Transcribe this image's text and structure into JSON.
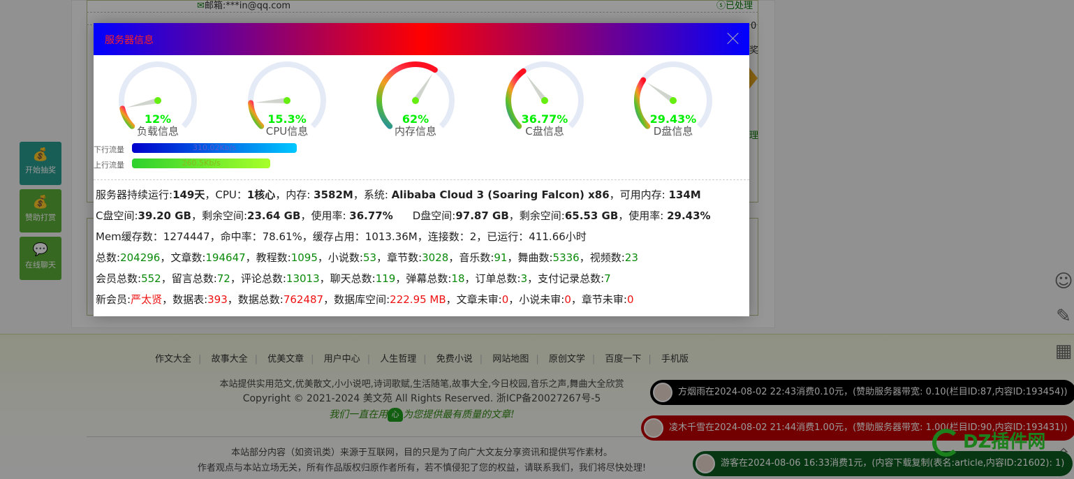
{
  "background": {
    "email_label": "邮箱:***in@qq.com",
    "processed_label": "已处理",
    "fragments": [
      "0",
      "奖",
      "理"
    ],
    "float_buttons": [
      {
        "label": "开始抽奖",
        "icon": "money-bag-icon",
        "color": "#2a9d8f"
      },
      {
        "label": "赞助打赏",
        "icon": "money-bag-icon",
        "color": "#5cae3a"
      },
      {
        "label": "在线聊天",
        "icon": "chat-bubbles-icon",
        "color": "#5cae3a"
      }
    ],
    "right_icons": [
      "smiley-icon",
      "edit-icon",
      "qrcode-icon",
      "desktop-icon",
      "share-icon",
      "back-to-top-icon"
    ],
    "footer": {
      "nav": [
        "作文大全",
        "故事大全",
        "优美文章",
        "用户中心",
        "人生哲理",
        "免费小说",
        "网站地图",
        "原创文学",
        "百度一下",
        "手机版"
      ],
      "description": "本站提供实用范文,优美散文,小小说吧,诗词歌赋,生活随笔,故事大全,今日校园,音乐之声,舞曲大全欣赏",
      "copyright": "Copyright © 2021-2024 美文苑 All Rights Reserved. 浙ICP备20027267号-5",
      "slogan_before": "我们一直在用",
      "slogan_heart": "心",
      "slogan_after": "为您提供最有质量的文章!",
      "disclaimer_1": "本站部分内容（如资讯类）来源于互联网，目的只是为了向广大文友分享资讯和提供写作素材。",
      "disclaimer_2": "作者观点与本站立场无关，所有作品版权归原作者所有，若不慎侵犯了您的权益，请联系我们，我们将尽快处理!"
    },
    "toasts": [
      {
        "text": "方烟雨在2024-08-02 22:43消费0.10元，(赞助服务器带宽: 0.10(栏目ID:87,内容ID:193454))",
        "color": "#000000"
      },
      {
        "text": "凌木千雪在2024-08-02 21:44消费1.00元，(赞助服务器带宽: 1.00(栏目ID:90,内容ID:193431))",
        "color": "#c00000"
      },
      {
        "text": "游客在2024-08-06 16:33消费1元，(内容下载复制(表名:article,内容ID:21602): 1)",
        "color": "#0a5a1e"
      }
    ],
    "watermark": "DZ插件网"
  },
  "modal": {
    "title": "服务器信息",
    "gauges": [
      {
        "label": "负载信息",
        "value_text": "12%",
        "percent": 12
      },
      {
        "label": "CPU信息",
        "value_text": "15.3%",
        "percent": 15.3
      },
      {
        "label": "内存信息",
        "value_text": "62%",
        "percent": 62
      },
      {
        "label": "C盘信息",
        "value_text": "36.77%",
        "percent": 36.77
      },
      {
        "label": "D盘信息",
        "value_text": "29.43%",
        "percent": 29.43
      }
    ],
    "traffic": [
      {
        "label": "下行流量",
        "value": "310.02Kb/s",
        "fill": 1.0,
        "colors": [
          "#0000cc",
          "#00c8ff"
        ],
        "text_color": "#5a5ad0"
      },
      {
        "label": "上行流量",
        "value": "260.5Kb/s",
        "fill": 0.84,
        "colors": [
          "#2ed12e",
          "#a8ff2a"
        ],
        "text_color": "#88b820"
      }
    ],
    "stats": {
      "uptime_label": "服务器持续运行:",
      "uptime": "149天",
      "cpu_label": "，CPU：",
      "cpu": "1核心",
      "mem_label": "，内存: ",
      "mem": "3582M",
      "os_label": "，系统: ",
      "os": "Alibaba Cloud 3 (Soaring Falcon) x86",
      "free_mem_label": "，可用内存: ",
      "free_mem": "134M",
      "c_space_label": "C盘空间:",
      "c_space": "39.20 GB",
      "c_free_label": "，剩余空间:",
      "c_free": "23.64 GB",
      "c_usage_label": "，使用率: ",
      "c_usage": "36.77%",
      "d_space_label": "D盘空间:",
      "d_space": "97.87 GB",
      "d_free_label": "，剩余空间:",
      "d_free": "65.53 GB",
      "d_usage_label": "，使用率: ",
      "d_usage": "29.43%",
      "mem_cache_line": "Mem缓存数：1274447，命中率：78.61%，缓存占用：1013.36M，连接数：2，已运行：411.66小时",
      "content_counts": [
        {
          "label": "总数:",
          "value": "204296"
        },
        {
          "label": "，文章数:",
          "value": "194647"
        },
        {
          "label": "，教程数:",
          "value": "1095"
        },
        {
          "label": "，小说数:",
          "value": "53"
        },
        {
          "label": "，章节数:",
          "value": "3028"
        },
        {
          "label": "，音乐数:",
          "value": "91"
        },
        {
          "label": "，舞曲数:",
          "value": "5336"
        },
        {
          "label": "，视频数:",
          "value": "23"
        }
      ],
      "member_counts": [
        {
          "label": "会员总数:",
          "value": "552"
        },
        {
          "label": "，留言总数:",
          "value": "72"
        },
        {
          "label": "，评论总数:",
          "value": "13013"
        },
        {
          "label": "，聊天总数:",
          "value": "119"
        },
        {
          "label": "，弹幕总数:",
          "value": "18"
        },
        {
          "label": "，订单总数:",
          "value": "3"
        },
        {
          "label": "，支付记录总数:",
          "value": "7"
        }
      ],
      "db_counts": [
        {
          "label": "新会员:",
          "value": "严太贤"
        },
        {
          "label": "，数据表:",
          "value": "393"
        },
        {
          "label": "，数据总数:",
          "value": "762487"
        },
        {
          "label": "，数据库空间:",
          "value": "222.95 MB"
        },
        {
          "label": "，文章未审:",
          "value": "0"
        },
        {
          "label": "，小说未审:",
          "value": "0"
        },
        {
          "label": "，章节未审:",
          "value": "0"
        }
      ]
    }
  }
}
